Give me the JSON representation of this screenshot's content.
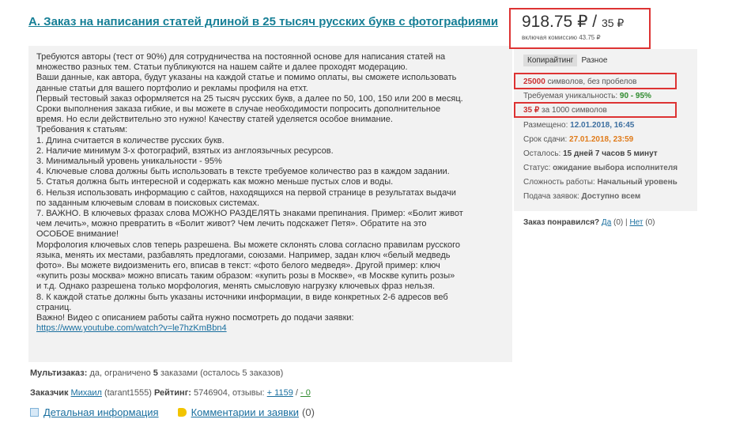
{
  "order": {
    "title": "А. Заказ на написания статей длиной в 25 тысяч русских букв с фотографиями",
    "description_lines": [
      "Требуются авторы (тест от 90%) для сотрудничества на постоянной основе для написания статей на",
      "множество разных тем. Статьи публикуются на нашем сайте и далее проходят модерацию.",
      "Ваши данные, как автора, будут указаны на каждой статье и помимо оплаты, вы сможете использовать",
      "данные статьи для вашего портфолио и рекламы профиля на етхт.",
      "Первый тестовый заказ оформляется на 25 тысяч русских букв, а далее по 50, 100, 150 или 200 в месяц.",
      "Сроки выполнения заказа гибкие, и вы можете в случае необходимости попросить дополнительное",
      "время. Но если действительно это нужно! Качеству статей уделяется особое внимание.",
      "Требования к статьям:",
      "1. Длина считается в количестве русских букв.",
      "2. Наличие минимум 3-х фотографий, взятых из англоязычных ресурсов.",
      "3. Минимальный уровень уникальности - 95%",
      "4. Ключевые слова должны быть использовать в тексте требуемое количество раз в каждом задании.",
      "5. Статья должна быть интересной и содержать как можно меньше пустых слов и воды.",
      "6. Нельзя использовать информацию с сайтов, находящихся на первой странице в результатах выдачи",
      "по заданным ключевым словам в поисковых системах.",
      "7. ВАЖНО. В ключевых фразах слова МОЖНО РАЗДЕЛЯТЬ знаками препинания. Пример: «Болит живот",
      "чем лечить», можно превратить в «Болит живот? Чем лечить подскажет Петя». Обратите на это",
      "ОСОБОЕ внимание!",
      "Морфология ключевых слов теперь разрешена. Вы можете склонять слова согласно правилам русского",
      "языка, менять их местами, разбавлять предлогами, союзами. Например, задан ключ «белый медведь",
      "фото». Вы можете видоизменить его, вписав в текст: «фото белого медведя». Другой пример: ключ",
      "«купить розы москва» можно вписать таким образом: «купить розы в Москве», «в Москве купить розы»",
      "и т.д. Однако разрешена только морфология, менять смысловую нагрузку ключевых фраз нельзя.",
      "8. К каждой статье должны быть указаны источники информации, в виде конкретных 2-6 адресов веб",
      "страниц.",
      "Важно! Видео с описанием работы сайта нужно посмотреть до подачи заявки:"
    ],
    "video_link": "https://www.youtube.com/watch?v=le7hzKmBbn4",
    "multi": {
      "label": "Мультизаказ:",
      "text_before": " да, ограничено ",
      "count": "5",
      "text_mid": " заказами (осталось ",
      "remaining": "5",
      "text_after": " заказов)"
    },
    "customer": {
      "label": "Заказчик",
      "name": "Михаил",
      "login": " (tarant1555) ",
      "rating_label": "Рейтинг:",
      "rating": " 5746904",
      "reviews_label": ", отзывы: ",
      "positive": "+ 1159",
      "separator": " / ",
      "negative": "- 0"
    },
    "links": {
      "details": "Детальная информация",
      "comments": "Комментарии и заявки",
      "comments_count": "(0)"
    }
  },
  "sidebar": {
    "price": "918.75 ₽",
    "price_sep": " / ",
    "price_per": "35 ₽",
    "commission_note": "включая комиссию 43.75 ₽",
    "tabs": [
      "Копирайтинг",
      "Разное"
    ],
    "volume_value": "25000",
    "volume_text": " символов, без пробелов",
    "uniq_label": "Требуемая уникальность: ",
    "uniq_value": "90 - 95%",
    "rate_value": "35 ₽",
    "rate_text": " за 1000 символов",
    "posted_label": "Размещено: ",
    "posted_value": "12.01.2018, 16:45",
    "deadline_label": "Срок сдачи: ",
    "deadline_value": "27.01.2018, 23:59",
    "remaining_label": "Осталось: ",
    "remaining_value": "15 дней 7 часов 5 минут",
    "status_label": "Статус: ",
    "status_value": "ожидание выбора исполнителя",
    "difficulty_label": "Сложность работы: ",
    "difficulty_value": "Начальный уровень",
    "access_label": "Подача заявок: ",
    "access_value": "Доступно всем",
    "liked_label": "Заказ понравился? ",
    "liked_yes": "Да",
    "liked_yes_count": " (0) ",
    "liked_sep": "| ",
    "liked_no": "Нет",
    "liked_no_count": " (0)"
  },
  "colors": {
    "title_link": "#167f96",
    "highlight_border": "#d33",
    "panel_bg": "#f2f2f2",
    "link": "#1a6f9f",
    "date_posted": "#3d6fa0",
    "deadline": "#e07b1a"
  }
}
